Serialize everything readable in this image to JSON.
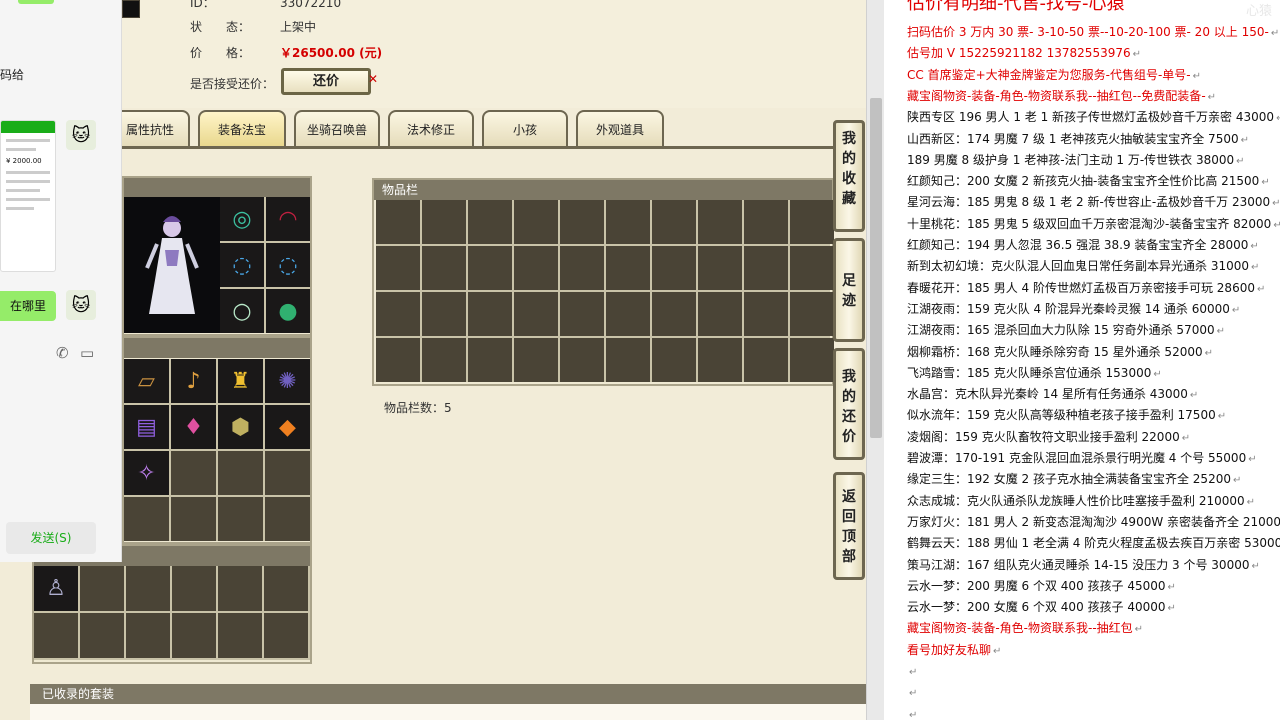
{
  "listing": {
    "id_label": "ID：",
    "id_value": "33072210",
    "status_label": "状　　态：",
    "status_value": "上架中",
    "price_label": "价　　格：",
    "price_value": "￥26500.00 (元)",
    "bargain_label": "是否接受还价：",
    "bargain_button": "还价",
    "bargain_mark": "✕"
  },
  "tabs": [
    {
      "label": "属性抗性",
      "active": false
    },
    {
      "label": "装备法宝",
      "active": true
    },
    {
      "label": "坐骑召唤兽",
      "active": false
    },
    {
      "label": "法术修正",
      "active": false
    },
    {
      "label": "小孩",
      "active": false
    },
    {
      "label": "外观道具",
      "active": false
    }
  ],
  "inventory": {
    "title": "物品栏",
    "count_text": "物品栏数：5"
  },
  "side_buttons": [
    {
      "label": "我的收藏"
    },
    {
      "label": "足迹"
    },
    {
      "label": "我的还价"
    },
    {
      "label": "返回顶部"
    }
  ],
  "suit_section": {
    "title": "已收录的套装"
  },
  "chat": {
    "snippet_text": "码给",
    "phone_amount": "¥ 2000.00",
    "question_bubble": "在哪里",
    "send_button": "发送(S)",
    "icons": [
      "phone-icon",
      "video-icon"
    ]
  },
  "doc": {
    "title_line": "估价有明细-代售-找号-心猿",
    "watermark": "心猿",
    "lines": [
      {
        "text": "扫码估价 3 万内 30 票- 3-10-50 票--10-20-100 票- 20 以上 150-",
        "color": "red"
      },
      {
        "text": "估号加 V 15225921182   13782553976",
        "color": "red"
      },
      {
        "text": "CC 首席鉴定+大神金牌鉴定为您服务-代售组号-单号-",
        "color": "red"
      },
      {
        "text": "藏宝阁物资-装备-角色-物资联系我--抽红包--免费配装备-",
        "color": "red"
      },
      {
        "text": "陕西专区 196 男人 1 老 1 新孩子传世燃灯孟极妙音千万亲密 43000",
        "color": "black"
      },
      {
        "text": "山西新区：174 男魔 7 级 1 老神孩克火抽敏装宝宝齐全 7500",
        "color": "black"
      },
      {
        "text": "189 男魔 8 级护身 1 老神孩-法门主动 1 万-传世铁衣 38000",
        "color": "black"
      },
      {
        "text": "红颜知己：200 女魔 2 新孩克火抽-装备宝宝齐全性价比高 21500",
        "color": "black"
      },
      {
        "text": "星河云海：185 男鬼 8 级 1 老 2 新-传世容止-孟极妙音千万 23000",
        "color": "black"
      },
      {
        "text": "十里桃花：185 男鬼 5 级双回血千万亲密混淘沙-装备宝宝齐 82000",
        "color": "black"
      },
      {
        "text": "红颜知己：194 男人忽混 36.5 强混 38.9 装备宝宝齐全 28000",
        "color": "black"
      },
      {
        "text": "新到太初幻境：克火队混人回血鬼日常任务副本异光通杀 31000",
        "color": "black"
      },
      {
        "text": "春暖花开：185 男人 4 阶传世燃灯孟极百万亲密接手可玩 28600",
        "color": "black"
      },
      {
        "text": "江湖夜雨：159 克火队 4 阶混异光秦岭灵猴 14 通杀 60000",
        "color": "black"
      },
      {
        "text": "江湖夜雨：165 混杀回血大力队除 15 穷奇外通杀 57000",
        "color": "black"
      },
      {
        "text": "烟柳霜桥：168 克火队睡杀除穷奇 15 星外通杀 52000",
        "color": "black"
      },
      {
        "text": "飞鸿踏雪：185 克火队睡杀宫位通杀 153000",
        "color": "black"
      },
      {
        "text": "水晶宫：克木队异光秦岭 14 星所有任务通杀 43000",
        "color": "black"
      },
      {
        "text": "似水流年：159 克火队高等级种植老孩子接手盈利 17500",
        "color": "black"
      },
      {
        "text": "凌烟阁：159 克火队畜牧符文职业接手盈利 22000",
        "color": "black"
      },
      {
        "text": "碧波潭：170-191 克金队混回血混杀景行明光魔 4 个号 55000",
        "color": "black"
      },
      {
        "text": "缘定三生：192 女魔 2 孩子克水抽全满装备宝宝齐全 25200",
        "color": "black"
      },
      {
        "text": "众志成城：克火队通杀队龙族睡人性价比哇塞接手盈利 210000",
        "color": "black"
      },
      {
        "text": "万家灯火：181 男人 2 新变态混淘淘沙 4900W 亲密装备齐全 210000",
        "color": "black"
      },
      {
        "text": "鹤舞云天：188 男仙 1 老全满 4 阶克火程度孟极去疾百万亲密 53000",
        "color": "black"
      },
      {
        "text": "策马江湖：167 组队克火通灵睡杀 14-15 没压力 3 个号 30000",
        "color": "black"
      },
      {
        "text": "云水一梦：200 男魔 6 个双 400 孩孩子 45000",
        "color": "black"
      },
      {
        "text": "云水一梦：200 女魔 6 个双 400 孩孩子 40000",
        "color": "black"
      },
      {
        "text": "藏宝阁物资-装备-角色-物资联系我--抽红包",
        "color": "red"
      },
      {
        "text": "看号加好友私聊",
        "color": "red"
      },
      {
        "text": "",
        "color": "black"
      },
      {
        "text": "",
        "color": "black"
      },
      {
        "text": "",
        "color": "black"
      }
    ]
  }
}
